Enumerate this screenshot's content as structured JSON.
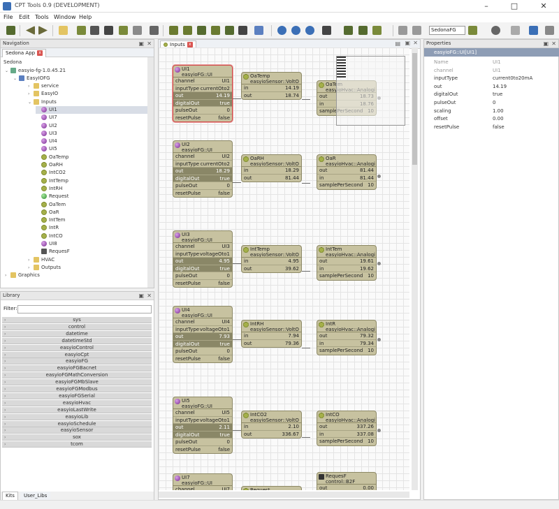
{
  "window": {
    "title": "CPT Tools 0.9 (DEVELOPMENT)"
  },
  "menu": [
    "File",
    "Edit",
    "Tools",
    "Window",
    "Help"
  ],
  "toolbar": {
    "platform_select": "SedonaFG"
  },
  "navigation": {
    "header": "Navigation",
    "tab": "Sedona App",
    "root": "Sedona",
    "device": "easyio-fg-1.0.45.21",
    "app": "EasyIOFG",
    "items": [
      {
        "label": "service",
        "icon": "folder",
        "indent": 3,
        "tw": "›"
      },
      {
        "label": "EasyIO",
        "icon": "folder",
        "indent": 3,
        "tw": "›"
      },
      {
        "label": "Inputs",
        "icon": "folder",
        "indent": 3,
        "tw": "⌄"
      },
      {
        "label": "UI1",
        "icon": "purple",
        "indent": 4,
        "tw": ""
      },
      {
        "label": "UI7",
        "icon": "purple",
        "indent": 4,
        "tw": ""
      },
      {
        "label": "UI2",
        "icon": "purple",
        "indent": 4,
        "tw": ""
      },
      {
        "label": "UI3",
        "icon": "purple",
        "indent": 4,
        "tw": ""
      },
      {
        "label": "UI4",
        "icon": "purple",
        "indent": 4,
        "tw": ""
      },
      {
        "label": "UI5",
        "icon": "purple",
        "indent": 4,
        "tw": ""
      },
      {
        "label": "OaTemp",
        "icon": "gear",
        "indent": 4,
        "tw": ""
      },
      {
        "label": "OaRH",
        "icon": "gear",
        "indent": 4,
        "tw": ""
      },
      {
        "label": "IntCO2",
        "icon": "gear",
        "indent": 4,
        "tw": ""
      },
      {
        "label": "IntTemp",
        "icon": "gear",
        "indent": 4,
        "tw": ""
      },
      {
        "label": "IntRH",
        "icon": "gear",
        "indent": 4,
        "tw": ""
      },
      {
        "label": "Request",
        "icon": "green",
        "indent": 4,
        "tw": ""
      },
      {
        "label": "OaTem",
        "icon": "gear",
        "indent": 4,
        "tw": ""
      },
      {
        "label": "OaR",
        "icon": "gear",
        "indent": 4,
        "tw": ""
      },
      {
        "label": "IntTem",
        "icon": "gear",
        "indent": 4,
        "tw": ""
      },
      {
        "label": "IntR",
        "icon": "gear",
        "indent": 4,
        "tw": ""
      },
      {
        "label": "IntCO",
        "icon": "gear",
        "indent": 4,
        "tw": ""
      },
      {
        "label": "UI8",
        "icon": "purple",
        "indent": 4,
        "tw": ""
      },
      {
        "label": "RequesF",
        "icon": "seq",
        "indent": 4,
        "tw": ""
      },
      {
        "label": "HVAC",
        "icon": "folder",
        "indent": 3,
        "tw": "›"
      },
      {
        "label": "Outputs",
        "icon": "folder",
        "indent": 3,
        "tw": "›"
      },
      {
        "label": "Graphics",
        "icon": "folder",
        "indent": 0,
        "tw": "›"
      }
    ]
  },
  "library": {
    "header": "Library",
    "filter_label": "Filter:",
    "filter_value": "",
    "kits": [
      "sys",
      "control",
      "datetime",
      "datetimeStd",
      "easyioControl",
      "easyioCpt",
      "easyioFG",
      "easyioFGBacnet",
      "easyioFGMathConversion",
      "easyioFGMbSlave",
      "easyioFGModbus",
      "easyioFGSerial",
      "easyioHvac",
      "easyioLastWrite",
      "easyioLib",
      "easyioSchedule",
      "easyioSensor",
      "sox",
      "tcom"
    ],
    "bottom_tabs": [
      "Kits",
      "User_Libs"
    ]
  },
  "editor": {
    "tab": "Inputs",
    "blocks": [
      {
        "name": "UI1",
        "type": "easyioFG::UI",
        "icon": "purple",
        "selected": true,
        "slots": [
          [
            "channel",
            "UI1"
          ],
          [
            "inputType",
            "currentOto2"
          ],
          [
            "out",
            "14.19"
          ],
          [
            "digitalOut",
            "true"
          ],
          [
            "pulseOut",
            "0"
          ],
          [
            "resetPulse",
            "false"
          ]
        ]
      },
      {
        "name": "OaTemp",
        "type": "easyioSensor::VoltO",
        "icon": "gear",
        "slots": [
          [
            "in",
            "14.19"
          ],
          [
            "out",
            "18.74"
          ]
        ]
      },
      {
        "name": "OaTem",
        "type": "easyioHvac::Analogi",
        "icon": "gear",
        "slots": [
          [
            "out",
            "18.73"
          ],
          [
            "in",
            "18.76"
          ],
          [
            "samplePerSecond",
            "10"
          ]
        ]
      },
      {
        "name": "UI2",
        "type": "easyioFG::UI",
        "icon": "purple",
        "slots": [
          [
            "channel",
            "UI2"
          ],
          [
            "inputType",
            "currentOto2"
          ],
          [
            "out",
            "18.29"
          ],
          [
            "digitalOut",
            "true"
          ],
          [
            "pulseOut",
            "0"
          ],
          [
            "resetPulse",
            "false"
          ]
        ]
      },
      {
        "name": "OaRH",
        "type": "easyioSensor::VoltO",
        "icon": "gear",
        "slots": [
          [
            "in",
            "18.29"
          ],
          [
            "out",
            "81.44"
          ]
        ]
      },
      {
        "name": "OaR",
        "type": "easyioHvac::Analogi",
        "icon": "gear",
        "slots": [
          [
            "out",
            "81.44"
          ],
          [
            "in",
            "81.44"
          ],
          [
            "samplePerSecond",
            "10"
          ]
        ]
      },
      {
        "name": "UI3",
        "type": "easyioFG::UI",
        "icon": "purple",
        "slots": [
          [
            "channel",
            "UI3"
          ],
          [
            "inputType",
            "voltageOto1"
          ],
          [
            "out",
            "4.95"
          ],
          [
            "digitalOut",
            "true"
          ],
          [
            "pulseOut",
            "0"
          ],
          [
            "resetPulse",
            "false"
          ]
        ]
      },
      {
        "name": "IntTemp",
        "type": "easyioSensor::VoltO",
        "icon": "gear",
        "slots": [
          [
            "in",
            "4.95"
          ],
          [
            "out",
            "39.62"
          ]
        ]
      },
      {
        "name": "IntTem",
        "type": "easyioHvac::Analogi",
        "icon": "gear",
        "slots": [
          [
            "out",
            "19.61"
          ],
          [
            "in",
            "19.62"
          ],
          [
            "samplePerSecond",
            "10"
          ]
        ]
      },
      {
        "name": "UI4",
        "type": "easyioFG::UI",
        "icon": "purple",
        "slots": [
          [
            "channel",
            "UI4"
          ],
          [
            "inputType",
            "voltageOto1"
          ],
          [
            "out",
            "7.93"
          ],
          [
            "digitalOut",
            "true"
          ],
          [
            "pulseOut",
            "0"
          ],
          [
            "resetPulse",
            "false"
          ]
        ]
      },
      {
        "name": "IntRH",
        "type": "easyioSensor::VoltO",
        "icon": "gear",
        "slots": [
          [
            "in",
            "7.94"
          ],
          [
            "out",
            "79.36"
          ]
        ]
      },
      {
        "name": "IntR",
        "type": "easyioHvac::Analogi",
        "icon": "gear",
        "slots": [
          [
            "out",
            "79.32"
          ],
          [
            "in",
            "79.34"
          ],
          [
            "samplePerSecond",
            "10"
          ]
        ]
      },
      {
        "name": "UI5",
        "type": "easyioFG::UI",
        "icon": "purple",
        "slots": [
          [
            "channel",
            "UI5"
          ],
          [
            "inputType",
            "voltageOto1"
          ],
          [
            "out",
            "2.11"
          ],
          [
            "digitalOut",
            "true"
          ],
          [
            "pulseOut",
            "0"
          ],
          [
            "resetPulse",
            "false"
          ]
        ]
      },
      {
        "name": "IntCO2",
        "type": "easyioSensor::VoltO",
        "icon": "gear",
        "slots": [
          [
            "in",
            "2.10"
          ],
          [
            "out",
            "336.67"
          ]
        ]
      },
      {
        "name": "IntCO",
        "type": "easyioHvac::Analogi",
        "icon": "gear",
        "slots": [
          [
            "out",
            "337.26"
          ],
          [
            "in",
            "337.08"
          ],
          [
            "samplePerSecond",
            "10"
          ]
        ]
      },
      {
        "name": "UI7",
        "type": "easyioFG::UI",
        "icon": "purple",
        "slots": [
          [
            "channel",
            "UI7"
          ]
        ]
      },
      {
        "name": "Request",
        "type": "",
        "icon": "gear",
        "slots": []
      },
      {
        "name": "RequesF",
        "type": "control::B2F",
        "icon": "seq",
        "slots": [
          [
            "out",
            "0.00"
          ]
        ]
      }
    ]
  },
  "properties": {
    "header": "Properties",
    "title": "easyioFG::UI[UI1]",
    "rows": [
      {
        "name": "Name",
        "value": "UI1",
        "muted": true
      },
      {
        "name": "channel",
        "value": "UI1",
        "muted": true
      },
      {
        "name": "inputType",
        "value": "current0to20mA",
        "muted": false
      },
      {
        "name": "out",
        "value": "14.19",
        "muted": false
      },
      {
        "name": "digitalOut",
        "value": "true",
        "muted": false
      },
      {
        "name": "pulseOut",
        "value": "0",
        "muted": false
      },
      {
        "name": "scaling",
        "value": "1.00",
        "muted": false
      },
      {
        "name": "offset",
        "value": "0.00",
        "muted": false
      },
      {
        "name": "resetPulse",
        "value": "false",
        "muted": false
      }
    ]
  },
  "colors": {
    "accent": "#3b6fb6",
    "block": "#c7c2a0",
    "selection": "#d34b4b"
  }
}
